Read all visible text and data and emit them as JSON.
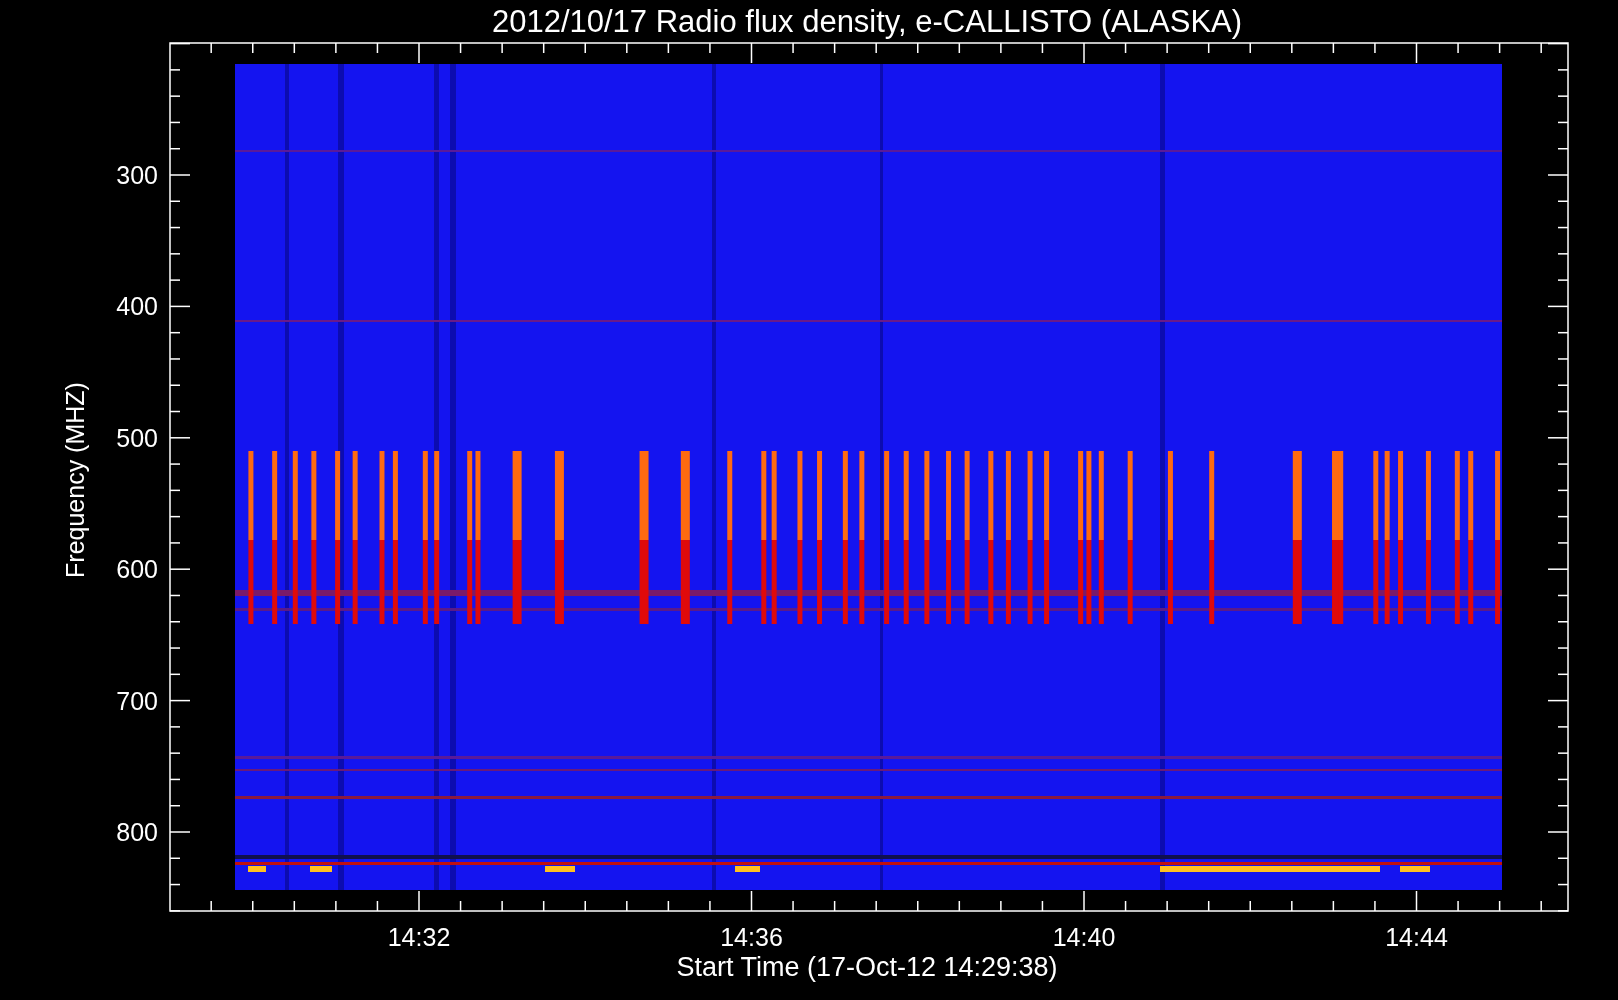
{
  "plot": {
    "title": "2012/10/17  Radio flux density, e-CALLISTO (ALASKA)",
    "ylabel": "Frequency (MHZ)",
    "xlabel": "Start Time (17-Oct-12 14:29:38)",
    "yticks": [
      "300",
      "400",
      "500",
      "600",
      "700",
      "800"
    ],
    "xticks": [
      "14:32",
      "14:36",
      "14:40",
      "14:44"
    ]
  }
}
